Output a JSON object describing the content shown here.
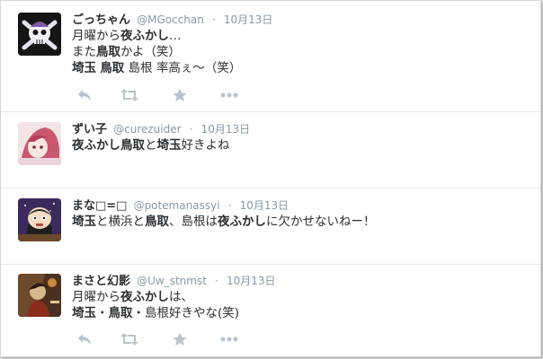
{
  "tweets": [
    {
      "name": "ごっちゃん",
      "handle": "@MGocchan",
      "separator": "·",
      "time": "10月13日",
      "avatar_icon": "skull-flag-icon",
      "lines": [
        [
          {
            "t": "月曜から",
            "b": false
          },
          {
            "t": "夜ふかし",
            "b": true
          },
          {
            "t": "…",
            "b": false
          }
        ],
        [
          {
            "t": "また",
            "b": false
          },
          {
            "t": "鳥取",
            "b": true
          },
          {
            "t": "かよ（笑）",
            "b": false
          }
        ],
        [
          {
            "t": "埼玉",
            "b": true
          },
          {
            "t": " ",
            "b": false
          },
          {
            "t": "鳥取",
            "b": true
          },
          {
            "t": " 島根 率高ぇ～（笑）",
            "b": false
          }
        ]
      ],
      "show_actions": true
    },
    {
      "name": "ずい子",
      "handle": "@curezuider",
      "separator": "·",
      "time": "10月13日",
      "avatar_icon": "anime-girl-avatar-icon",
      "lines": [
        [
          {
            "t": "夜ふかし",
            "b": true
          },
          {
            "t": "鳥取",
            "b": true
          },
          {
            "t": "と",
            "b": false
          },
          {
            "t": "埼玉",
            "b": true
          },
          {
            "t": "好きよね",
            "b": false
          }
        ]
      ],
      "show_actions": false
    },
    {
      "name": "まな□=□",
      "handle": "@potemanassyi",
      "separator": "·",
      "time": "10月13日",
      "avatar_icon": "cartoon-character-avatar-icon",
      "lines": [
        [
          {
            "t": "埼玉",
            "b": true
          },
          {
            "t": "と横浜と",
            "b": false
          },
          {
            "t": "鳥取",
            "b": true
          },
          {
            "t": "、島根は",
            "b": false
          },
          {
            "t": "夜ふかし",
            "b": true
          },
          {
            "t": "に欠かせないねー！",
            "b": false
          }
        ]
      ],
      "show_actions": false
    },
    {
      "name": "まさと幻影",
      "handle": "@Uw_stnmst",
      "separator": "·",
      "time": "10月13日",
      "avatar_icon": "illustration-avatar-icon",
      "lines": [
        [
          {
            "t": "月曜から",
            "b": false
          },
          {
            "t": "夜ふかし",
            "b": true
          },
          {
            "t": "は、",
            "b": false
          }
        ],
        [
          {
            "t": "埼玉",
            "b": true
          },
          {
            "t": "・",
            "b": false
          },
          {
            "t": "鳥取",
            "b": true
          },
          {
            "t": "・",
            "b": false
          },
          {
            "t": "島根好きやな(笑)",
            "b": false
          }
        ]
      ],
      "show_actions": true
    }
  ],
  "actions": {
    "reply_icon": "reply-icon",
    "retweet_icon": "retweet-icon",
    "favorite_icon": "star-icon",
    "more_icon": "more-dots-icon"
  },
  "colors": {
    "name": "#292f33",
    "meta": "#8899a6",
    "action_icon": "#b8c3cb",
    "divider": "#e6e6e6"
  }
}
